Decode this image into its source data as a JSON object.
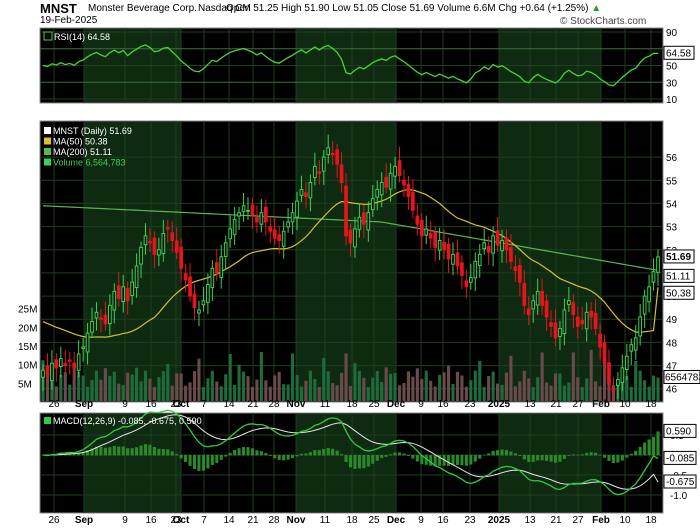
{
  "header": {
    "symbol": "MNST",
    "company": "Monster Beverage Corp.",
    "exchange": "Nasdaq CM",
    "date": "19-Feb-2025",
    "quote": "Open 51.25  High 51.90  Low 51.05  Close 51.69  Volume 6.6M  Chg +0.64 (+1.25%)",
    "quote_arrow": "▲",
    "credit": "© StockCharts.com"
  },
  "colors": {
    "panel_bg": "#000000",
    "grid": "#1f3d1f",
    "band": "#0e2a10",
    "up": "#39d353",
    "down": "#e8141d",
    "rsi": "#4cd137",
    "ma50": "#d6c22a",
    "ma200": "#59b84a",
    "vol_up": "#1e6b3c",
    "vol_down": "#6a4a4a",
    "macd_line": "#2ecc40",
    "signal_line": "#e8e8e8",
    "hist": "#2a8a2a"
  },
  "rsi_panel": {
    "legend": "RSI(14) 64.58",
    "levels": [
      "90",
      "70",
      "50",
      "30",
      "10"
    ],
    "last_label": "64.58"
  },
  "price_panel": {
    "legend": [
      {
        "text": "MNST (Daily) 51.69",
        "color": "#ffffff",
        "swatch": "#ffffff"
      },
      {
        "text": "MA(50) 50.38",
        "color": "#ffffff",
        "swatch": "#d6c22a"
      },
      {
        "text": "MA(200) 51.11",
        "color": "#ffffff",
        "swatch": "#59b84a"
      },
      {
        "text": "Volume 6,564,783",
        "color": "#39d353",
        "swatch": "#39d353"
      }
    ],
    "price_ticks": [
      "56",
      "55",
      "54",
      "53",
      "52",
      "51",
      "50",
      "49",
      "48",
      "47",
      "46"
    ],
    "volume_ticks": [
      "25M",
      "20M",
      "15M",
      "10M",
      "5M"
    ],
    "last_close": "51.69",
    "ma200_label": "51.11",
    "ma50_label": "50.38",
    "volume_label": "6564783"
  },
  "macd_panel": {
    "legend": "MACD(12,26,9) -0.085, -0.675, 0.590",
    "ticks": [
      "0.5",
      "0.0",
      "-0.5",
      "-1.0"
    ],
    "label_hist": "0.590",
    "label_macd": "-0.085",
    "label_signal": "-0.675"
  },
  "x_axis": {
    "labels": [
      {
        "text": "26",
        "bold": false
      },
      {
        "text": "Sep",
        "bold": true
      },
      {
        "text": "9",
        "bold": false
      },
      {
        "text": "16",
        "bold": false
      },
      {
        "text": "23",
        "bold": false
      },
      {
        "text": "Oct",
        "bold": true
      },
      {
        "text": "7",
        "bold": false
      },
      {
        "text": "14",
        "bold": false
      },
      {
        "text": "21",
        "bold": false
      },
      {
        "text": "28",
        "bold": false
      },
      {
        "text": "Nov",
        "bold": true
      },
      {
        "text": "11",
        "bold": false
      },
      {
        "text": "18",
        "bold": false
      },
      {
        "text": "25",
        "bold": false
      },
      {
        "text": "Dec",
        "bold": true
      },
      {
        "text": "9",
        "bold": false
      },
      {
        "text": "16",
        "bold": false
      },
      {
        "text": "23",
        "bold": false
      },
      {
        "text": "2025",
        "bold": true
      },
      {
        "text": "13",
        "bold": false
      },
      {
        "text": "21",
        "bold": false
      },
      {
        "text": "27",
        "bold": false
      },
      {
        "text": "Feb",
        "bold": true
      },
      {
        "text": "10",
        "bold": false
      },
      {
        "text": "18",
        "bold": false
      }
    ]
  },
  "chart_data": {
    "type": "candlestick",
    "ticker": "MNST",
    "price_range": [
      45.6,
      57.3
    ],
    "closes": [
      46.8,
      46.6,
      47.1,
      46.9,
      47.3,
      47.0,
      47.2,
      46.9,
      47.5,
      47.8,
      48.4,
      48.9,
      49.3,
      49.0,
      48.8,
      49.6,
      50.2,
      49.9,
      50.4,
      49.8,
      50.6,
      51.3,
      52.1,
      52.6,
      52.3,
      51.8,
      52.0,
      52.7,
      52.9,
      52.4,
      51.9,
      51.2,
      50.7,
      50.0,
      49.5,
      49.4,
      49.8,
      50.5,
      51.2,
      51.0,
      51.7,
      52.3,
      52.9,
      53.3,
      53.6,
      53.9,
      53.7,
      53.5,
      53.2,
      53.6,
      53.2,
      52.8,
      52.5,
      52.4,
      52.8,
      53.2,
      53.6,
      54.1,
      54.6,
      54.3,
      54.9,
      55.6,
      55.3,
      56.0,
      56.4,
      56.1,
      55.7,
      54.9,
      52.6,
      52.3,
      52.9,
      53.4,
      53.1,
      53.6,
      54.2,
      54.6,
      54.9,
      54.7,
      55.3,
      55.6,
      55.2,
      54.8,
      54.3,
      53.7,
      53.1,
      52.6,
      52.9,
      52.5,
      52.1,
      52.4,
      52.0,
      51.6,
      51.8,
      51.3,
      50.9,
      50.4,
      50.8,
      51.5,
      51.8,
      52.3,
      51.9,
      52.6,
      52.2,
      52.4,
      52.0,
      51.5,
      51.1,
      50.6,
      49.6,
      49.2,
      49.8,
      50.2,
      49.6,
      49.1,
      48.7,
      48.2,
      48.6,
      49.4,
      49.8,
      49.2,
      48.7,
      48.8,
      49.3,
      49.1,
      48.6,
      47.8,
      47.1,
      46.2,
      45.9,
      46.4,
      46.9,
      47.4,
      47.9,
      48.2,
      49.1,
      50.0,
      50.4,
      51.05,
      51.69
    ],
    "ma200": {
      "start": 53.9,
      "end": 51.11
    },
    "ma50": {
      "start": 48.9,
      "end": 50.38
    },
    "last": {
      "open": 51.25,
      "high": 51.9,
      "low": 51.05,
      "close": 51.69,
      "volume": 6564783,
      "chg": 0.64,
      "chg_pct": 1.25
    },
    "rsi_last": 64.58,
    "macd_last": {
      "macd": -0.085,
      "signal": -0.675,
      "histogram": 0.59
    }
  }
}
